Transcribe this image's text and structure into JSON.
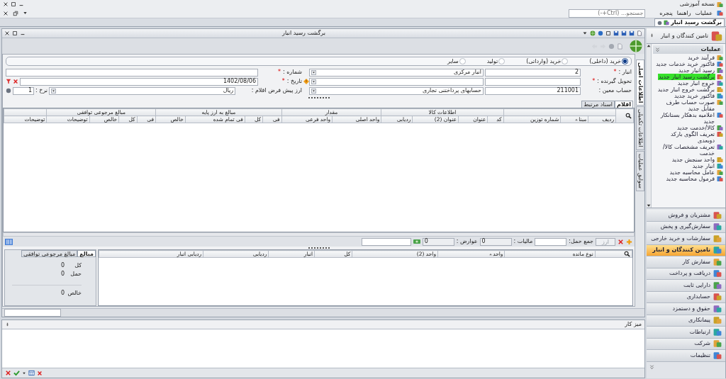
{
  "app": {
    "title": "نسخه آموزشی"
  },
  "menu": [
    {
      "label": "عملیات"
    },
    {
      "label": "راهنما"
    },
    {
      "label": "پنجره"
    }
  ],
  "search": {
    "placeholder": "جستجو... (Ctrl+-)"
  },
  "open_tabs": [
    {
      "label": "برگشت رسید انبار",
      "selected": true
    }
  ],
  "document": {
    "title": "برگشت رسید انبار",
    "side_tabs": [
      {
        "label": "اطلاعات اصلی",
        "selected": true
      },
      {
        "label": "اطلاعات تکمیلی",
        "selected": false
      },
      {
        "label": "سوابق عملیات",
        "selected": false
      }
    ],
    "purchase_types": [
      {
        "label": "خرید (داخلی)",
        "selected": true
      },
      {
        "label": "خرید (وارداتی)",
        "selected": false
      },
      {
        "label": "تولید",
        "selected": false
      },
      {
        "label": "سایر",
        "selected": false
      }
    ],
    "form_rows": [
      {
        "right": {
          "kind": "code_combo",
          "label": "انبار :",
          "required_mark": "*",
          "code": "2",
          "combo_value": "انبار مرکزی"
        },
        "left": {
          "kind": "text",
          "label": "شماره :",
          "required_mark": "*"
        }
      },
      {
        "right": {
          "kind": "code_combo",
          "label": "تحویل گیرنده :",
          "required_mark": "*"
        },
        "left": {
          "kind": "date",
          "label": "تاریخ :",
          "required_mark": "*",
          "value": "1402/08/06"
        }
      },
      {
        "right": {
          "kind": "code_combo",
          "label": "حساب معین :",
          "code": "211001",
          "combo_value": "حسابهای پرداختنی تجاری"
        },
        "left": {
          "kind": "currency",
          "label": "ارز پیش فرض اقلام :",
          "value": "ریال",
          "rate_label": "نرخ :",
          "rate": "1"
        }
      }
    ],
    "item_tabs": [
      {
        "label": "اقلام",
        "selected": true
      },
      {
        "label": "اسناد مرتبط",
        "selected": false
      }
    ],
    "items_grid": {
      "groups": [
        {
          "columns": [
            {
              "label": "ردیف",
              "sorted": false
            },
            {
              "label": "مبنا",
              "sorted": true
            },
            {
              "label": "شماره توزین",
              "sorted": false
            }
          ]
        },
        {
          "label": "اطلاعات کالا",
          "columns": [
            {
              "label": "کد",
              "sorted": false
            },
            {
              "label": "عنوان",
              "sorted": false
            },
            {
              "label": "عنوان (2)",
              "sorted": false
            },
            {
              "label": "ردیابی",
              "sorted": false
            }
          ]
        },
        {
          "label": "مقدار",
          "columns": [
            {
              "label": "واحد اصلی",
              "sorted": false
            },
            {
              "label": "واحد فرعی",
              "sorted": false
            }
          ]
        },
        {
          "label": "مبالغ به ارز پایه",
          "columns": [
            {
              "label": "فی",
              "sorted": false
            },
            {
              "label": "کل",
              "sorted": false
            },
            {
              "label": "فی تمام شده",
              "sorted": false
            },
            {
              "label": "خالص",
              "sorted": false
            }
          ]
        },
        {
          "label": "مبالغ مرجوعی توافقی",
          "columns": [
            {
              "label": "فی",
              "sorted": false
            },
            {
              "label": "کل",
              "sorted": false
            },
            {
              "label": "خالص",
              "sorted": false
            },
            {
              "label": "توضیحات",
              "sorted": false
            }
          ]
        },
        {
          "columns": [
            {
              "label": "توضیحات",
              "sorted": false
            }
          ]
        }
      ]
    },
    "totals_bar": {
      "currency_button": {
        "label": "ارز",
        "disabled": true
      },
      "fields": [
        {
          "label": "جمع حمل:"
        },
        {
          "label": "مالیات :",
          "value": "0"
        },
        {
          "label": "عوارض :",
          "value": "0"
        }
      ]
    },
    "stock_grid": {
      "columns": [
        {
          "label": "نوع مانده",
          "sorted": false
        },
        {
          "label": "واحد",
          "sorted": true
        },
        {
          "label": "واحد (2)",
          "sorted": false
        },
        {
          "label": "کل",
          "sorted": false
        },
        {
          "label": "انبار",
          "sorted": false
        },
        {
          "label": "ردیابی",
          "sorted": false
        },
        {
          "label": "ردیابی انبار",
          "sorted": false
        }
      ]
    },
    "amount_tabs": [
      {
        "label": "مبالغ",
        "selected": true
      },
      {
        "label": "مبالغ مرجوعی توافقی",
        "selected": false
      }
    ],
    "amounts": [
      {
        "label": "کل",
        "value": "0"
      },
      {
        "label": "حمل",
        "value": "0"
      },
      {
        "label": "خالص",
        "value": "0"
      }
    ]
  },
  "workspace": {
    "title": "میز کار"
  },
  "sidebar": {
    "title": "تامین کنندگان و انبار",
    "section": "عملیات",
    "actions": [
      {
        "label": "فرآیند خرید",
        "selected": false
      },
      {
        "label": "فاکتور خرید خدمات جدید",
        "selected": false
      },
      {
        "label": "رسید انبار جدید",
        "selected": false
      },
      {
        "label": "برگشت رسید انبار جدید",
        "selected": true
      },
      {
        "label": "خروج انبار جدید",
        "selected": false
      },
      {
        "label": "برگشت خروج انبار جدید",
        "selected": false
      },
      {
        "label": "فاکتور خرید جدید",
        "selected": false
      },
      {
        "label": "صورت حساب طرف مقابل جدید",
        "selected": false
      },
      {
        "label": "اعلامیه بدهکار بستانکار جدید",
        "selected": false
      },
      {
        "label": "کالا/خدمت جدید",
        "selected": false
      },
      {
        "label": "تعریف الگوی بارکد دوبعدی",
        "selected": false
      },
      {
        "label": "تعریف مشخصات کالا/خدمت",
        "selected": false
      },
      {
        "label": "واحد سنجش جدید",
        "selected": false
      },
      {
        "label": "انبار جدید",
        "selected": false
      },
      {
        "label": "عامل محاسبه جدید",
        "selected": false
      },
      {
        "label": "فرمول محاسبه جدید",
        "selected": false
      }
    ],
    "modules": [
      {
        "label": "مشتریان و فروش",
        "selected": false
      },
      {
        "label": "سفارش‌گیری و پخش",
        "selected": false
      },
      {
        "label": "سفارشات و خرید خارجی",
        "selected": false
      },
      {
        "label": "تامین کنندگان و انبار",
        "selected": true
      },
      {
        "label": "سفارش کار",
        "selected": false
      },
      {
        "label": "دریافت و پرداخت",
        "selected": false
      },
      {
        "label": "دارایی ثابت",
        "selected": false
      },
      {
        "label": "حسابداری",
        "selected": false
      },
      {
        "label": "حقوق و دستمزد",
        "selected": false
      },
      {
        "label": "پیمانکاری",
        "selected": false
      },
      {
        "label": "ارتباطات",
        "selected": false
      },
      {
        "label": "شرکت",
        "selected": false
      },
      {
        "label": "تنظیمات",
        "selected": false
      }
    ]
  }
}
